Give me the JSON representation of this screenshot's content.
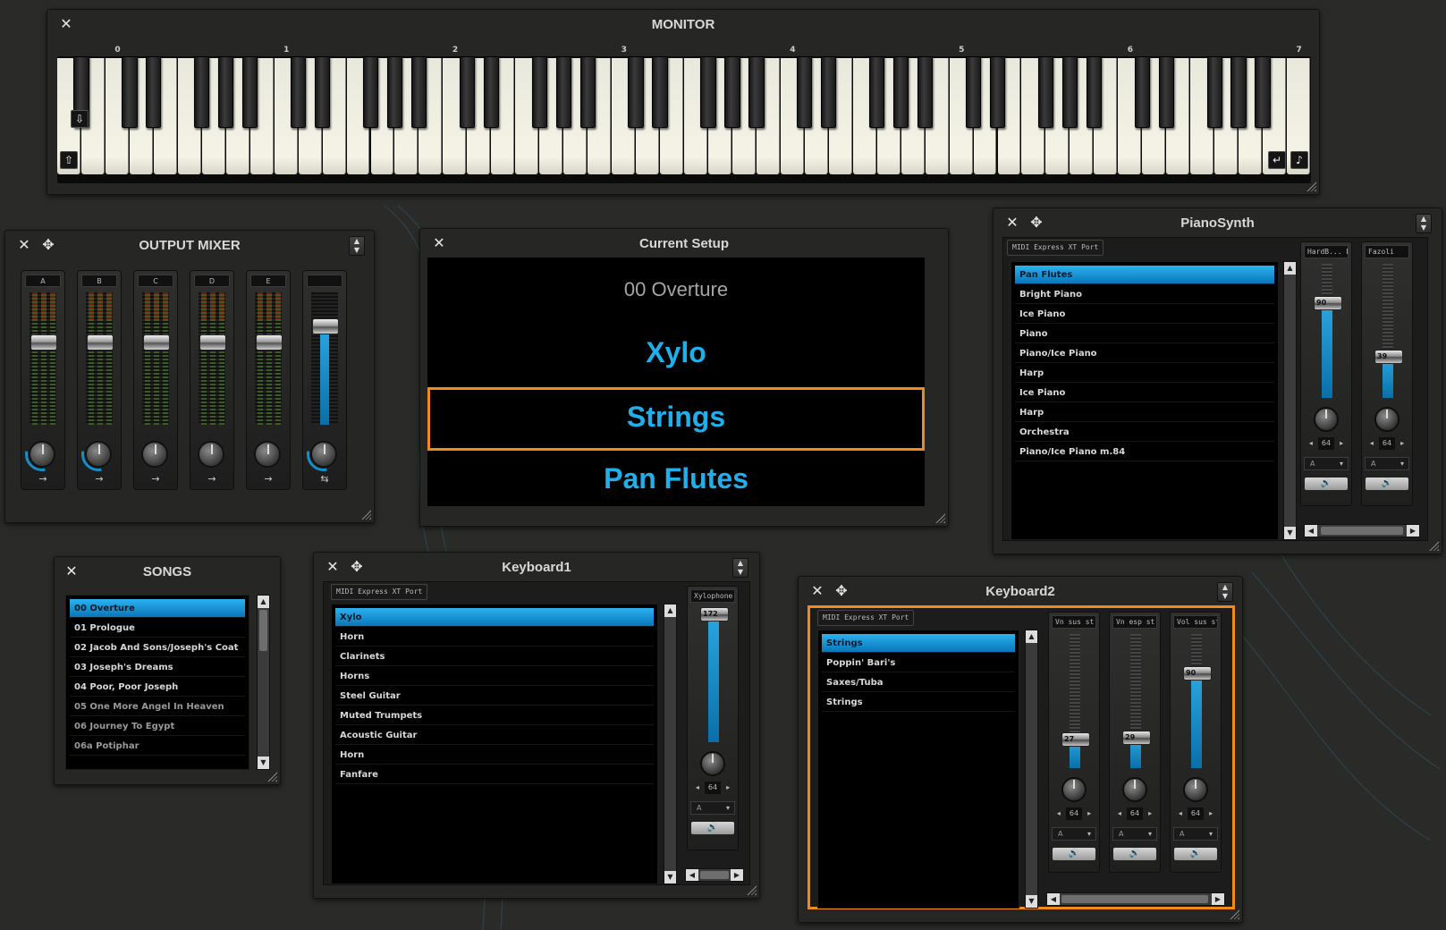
{
  "monitor": {
    "title": "MONITOR",
    "octaves": [
      "0",
      "1",
      "2",
      "3",
      "4",
      "5",
      "6",
      "7"
    ]
  },
  "output_mixer": {
    "title": "OUTPUT MIXER",
    "channels": [
      {
        "label": "A",
        "level": 0.62
      },
      {
        "label": "B",
        "level": 0.62
      },
      {
        "label": "C",
        "level": 0.62
      },
      {
        "label": "D",
        "level": 0.62
      },
      {
        "label": "E",
        "level": 0.62
      },
      {
        "label": "",
        "level": 0.74
      }
    ]
  },
  "current_setup": {
    "title": "Current Setup",
    "song": "00 Overture",
    "previous": "Xylo",
    "current": "Strings",
    "next": "Pan Flutes"
  },
  "piano_synth": {
    "title": "PianoSynth",
    "port": "MIDI Express XT Port",
    "items": [
      "Pan Flutes",
      "Bright Piano",
      "Ice Piano",
      "Piano",
      "Piano/Ice Piano",
      "Harp",
      "Ice Piano",
      "Harp",
      "Orchestra",
      "Piano/Ice Piano m.84"
    ],
    "selected": 0,
    "channels": [
      {
        "name": "HardB... Blow",
        "value": "90",
        "pan": "64",
        "out": "A"
      },
      {
        "name": "Fazoli",
        "value": "39",
        "pan": "64",
        "out": "A"
      }
    ]
  },
  "songs": {
    "title": "SONGS",
    "items": [
      "00 Overture",
      "01 Prologue",
      "02 Jacob And Sons/Joseph's Coat",
      "03 Joseph's Dreams",
      "04 Poor, Poor Joseph",
      "05 One More Angel In Heaven",
      "06 Journey To Egypt",
      "06a Potiphar"
    ],
    "selected": 0
  },
  "keyboard1": {
    "title": "Keyboard1",
    "port": "MIDI Express XT Port",
    "items": [
      "Xylo",
      "Horn",
      "Clarinets",
      "Horns",
      "Steel Guitar",
      "Muted Trumpets",
      "Acoustic Guitar",
      "Horn",
      "Fanfare"
    ],
    "selected": 0,
    "channels": [
      {
        "name": "Xylophone yarn",
        "value": "172",
        "pan": "64",
        "out": "A"
      }
    ]
  },
  "keyboard2": {
    "title": "Keyboard2",
    "port": "MIDI Express XT Port",
    "items": [
      "Strings",
      "Poppin' Bari's",
      "Saxes/Tuba",
      "Strings"
    ],
    "selected": 0,
    "channels": [
      {
        "name": "Vn sus st",
        "value": "27",
        "pan": "64",
        "out": "A"
      },
      {
        "name": "Vn esp st",
        "value": "29",
        "pan": "64",
        "out": "A"
      },
      {
        "name": "Vol sus st",
        "value": "90",
        "pan": "64",
        "out": "A"
      }
    ]
  },
  "colors": {
    "accent": "#1fb0ec",
    "highlight": "#f08a1c",
    "background": "#2a2b28"
  }
}
